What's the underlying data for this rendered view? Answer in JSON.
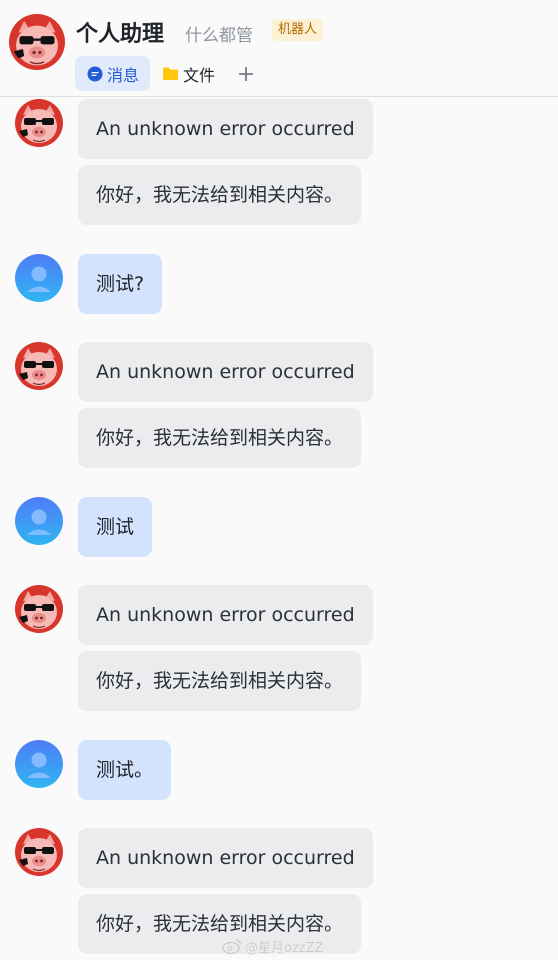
{
  "header": {
    "title": "个人助理",
    "subtitle": "什么都管",
    "tag": "机器人",
    "avatar_icon": "pig-sunglasses-avatar",
    "tabs": [
      {
        "label": "消息",
        "icon": "chat-bubble-icon",
        "active": true
      },
      {
        "label": "文件",
        "icon": "folder-icon",
        "active": false
      }
    ],
    "add_tab_icon": "plus-icon"
  },
  "messages": [
    {
      "role": "bot",
      "text1": "An unknown error occurred",
      "text2": "你好，我无法给到相关内容。"
    },
    {
      "role": "user",
      "text": "测试?"
    },
    {
      "role": "bot",
      "text1": "An unknown error occurred",
      "text2": "你好，我无法给到相关内容。"
    },
    {
      "role": "user",
      "text": "测试"
    },
    {
      "role": "bot",
      "text1": "An unknown error occurred",
      "text2": "你好，我无法给到相关内容。"
    },
    {
      "role": "user",
      "text": "测试。"
    },
    {
      "role": "bot",
      "text1": "An unknown error occurred",
      "text2": "你好，我无法给到相关内容。"
    }
  ],
  "watermark": "@星月ozzZZ",
  "colors": {
    "accent": "#245bdb",
    "user_bubble": "#d4e3fd",
    "bot_bubble": "#ebecee",
    "tag_bg": "#fcf1d4"
  }
}
